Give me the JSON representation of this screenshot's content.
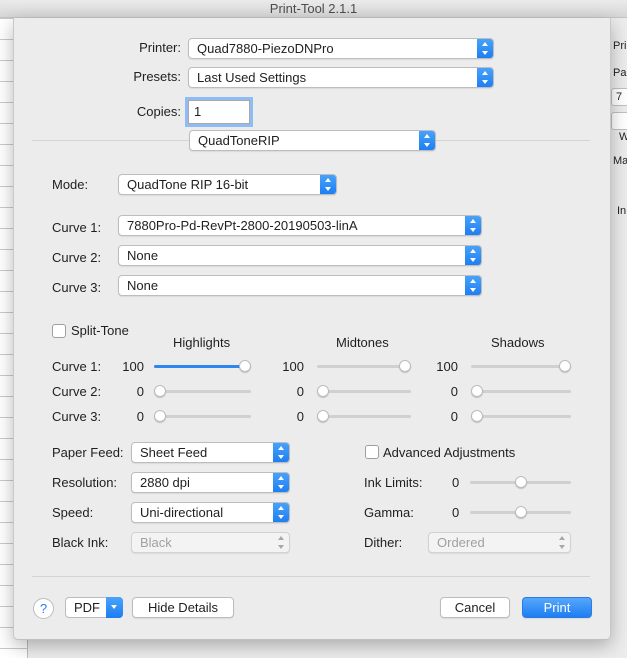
{
  "window": {
    "title": "Print-Tool 2.1.1"
  },
  "background": {
    "right_labels": [
      "Prir",
      "Pag",
      "7",
      "W",
      "Ma",
      "In"
    ]
  },
  "printer": {
    "label": "Printer:",
    "value": "Quad7880-PiezoDNPro"
  },
  "presets": {
    "label": "Presets:",
    "value": "Last Used Settings"
  },
  "copies": {
    "label": "Copies:",
    "value": "1"
  },
  "panel_selector": {
    "value": "QuadToneRIP"
  },
  "mode": {
    "label": "Mode:",
    "value": "QuadTone RIP 16-bit"
  },
  "curves": [
    {
      "label": "Curve 1:",
      "value": "7880Pro-Pd-RevPt-2800-20190503-linA"
    },
    {
      "label": "Curve 2:",
      "value": "None"
    },
    {
      "label": "Curve 3:",
      "value": "None"
    }
  ],
  "split_tone": {
    "label": "Split-Tone",
    "checked": false,
    "headers": [
      "Highlights",
      "Midtones",
      "Shadows"
    ],
    "rows": [
      {
        "label": "Curve 1:",
        "values": [
          "100",
          "100",
          "100"
        ],
        "levels": [
          100,
          100,
          100
        ],
        "max": 100
      },
      {
        "label": "Curve 2:",
        "values": [
          "0",
          "0",
          "0"
        ],
        "levels": [
          0,
          0,
          0
        ],
        "max": 100
      },
      {
        "label": "Curve 3:",
        "values": [
          "0",
          "0",
          "0"
        ],
        "levels": [
          0,
          0,
          0
        ],
        "max": 100
      }
    ]
  },
  "paper_feed": {
    "label": "Paper Feed:",
    "value": "Sheet Feed"
  },
  "resolution": {
    "label": "Resolution:",
    "value": "2880 dpi"
  },
  "speed": {
    "label": "Speed:",
    "value": "Uni-directional"
  },
  "black_ink": {
    "label": "Black Ink:",
    "value": "Black",
    "enabled": false
  },
  "advanced": {
    "label": "Advanced Adjustments",
    "checked": false
  },
  "ink_limits": {
    "label": "Ink Limits:",
    "value": "0",
    "level": 0.5
  },
  "gamma": {
    "label": "Gamma:",
    "value": "0",
    "level": 0.5
  },
  "dither": {
    "label": "Dither:",
    "value": "Ordered",
    "enabled": false
  },
  "footer": {
    "help": "?",
    "pdf": "PDF",
    "hide_details": "Hide Details",
    "cancel": "Cancel",
    "print": "Print"
  },
  "colors": {
    "accent": "#1d7ef2",
    "slider_fill": "#2e86f0"
  },
  "icons": [
    "help-icon",
    "popup-stepper-icon",
    "chevron-down-icon",
    "checkbox-icon"
  ]
}
